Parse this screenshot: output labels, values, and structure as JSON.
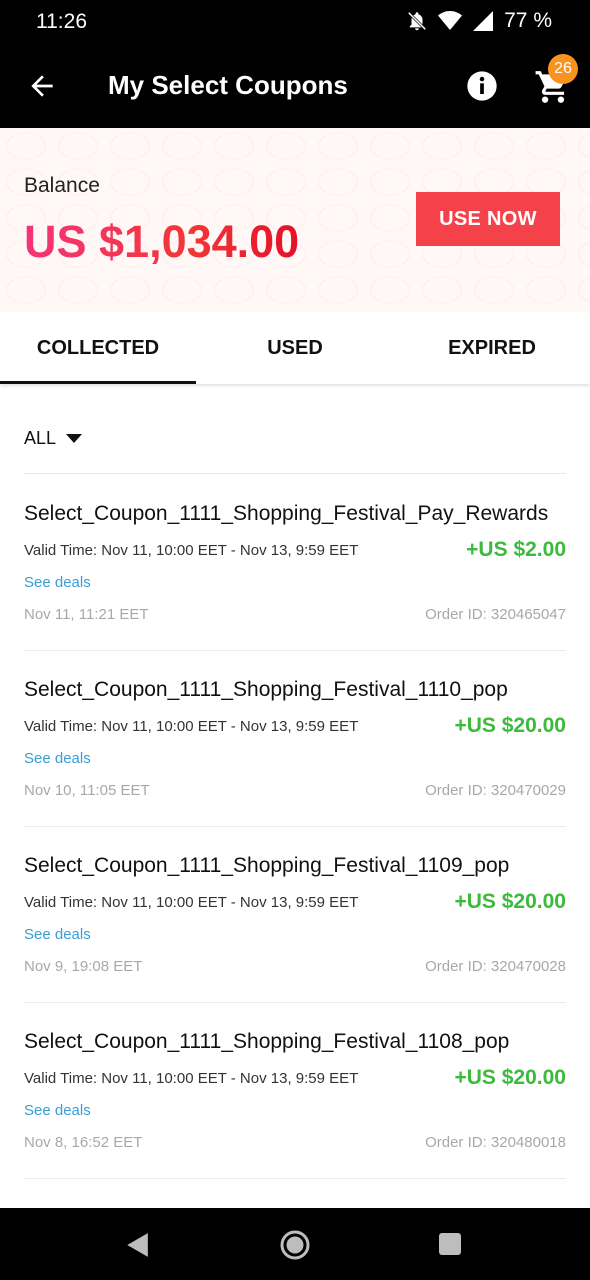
{
  "status_bar": {
    "time": "11:26",
    "battery": "77 %",
    "icons": [
      "notifications-off-icon",
      "wifi-icon",
      "signal-icon"
    ]
  },
  "app_bar": {
    "title": "My Select Coupons",
    "cart_badge": "26",
    "icons": [
      "back-arrow-icon",
      "info-icon",
      "cart-icon"
    ]
  },
  "balance": {
    "label": "Balance",
    "amount": "US $1,034.00",
    "use_now": "USE NOW"
  },
  "tabs": [
    {
      "label": "COLLECTED",
      "active": true
    },
    {
      "label": "USED",
      "active": false
    },
    {
      "label": "EXPIRED",
      "active": false
    }
  ],
  "filter": {
    "label": "ALL"
  },
  "coupons": [
    {
      "name": "Select_Coupon_1111_Shopping_Festival_Pay_Rewards",
      "valid": "Valid Time: Nov 11, 10:00 EET - Nov 13, 9:59 EET",
      "value": "+US $2.00",
      "deals": "See deals",
      "date": "Nov 11, 11:21 EET",
      "order": "Order ID: 320465047"
    },
    {
      "name": "Select_Coupon_1111_Shopping_Festival_1110_pop",
      "valid": "Valid Time: Nov 11, 10:00 EET - Nov 13, 9:59 EET",
      "value": "+US $20.00",
      "deals": "See deals",
      "date": "Nov 10, 11:05 EET",
      "order": "Order ID: 320470029"
    },
    {
      "name": "Select_Coupon_1111_Shopping_Festival_1109_pop",
      "valid": "Valid Time: Nov 11, 10:00 EET - Nov 13, 9:59 EET",
      "value": "+US $20.00",
      "deals": "See deals",
      "date": "Nov 9, 19:08 EET",
      "order": "Order ID: 320470028"
    },
    {
      "name": "Select_Coupon_1111_Shopping_Festival_1108_pop",
      "valid": "Valid Time: Nov 11, 10:00 EET - Nov 13, 9:59 EET",
      "value": "+US $20.00",
      "deals": "See deals",
      "date": "Nov 8, 16:52 EET",
      "order": "Order ID: 320480018"
    }
  ],
  "colors": {
    "accent_red": "#f5424a",
    "value_green": "#3cba3c",
    "link_blue": "#3a9dd4",
    "badge_orange": "#f7931e"
  }
}
